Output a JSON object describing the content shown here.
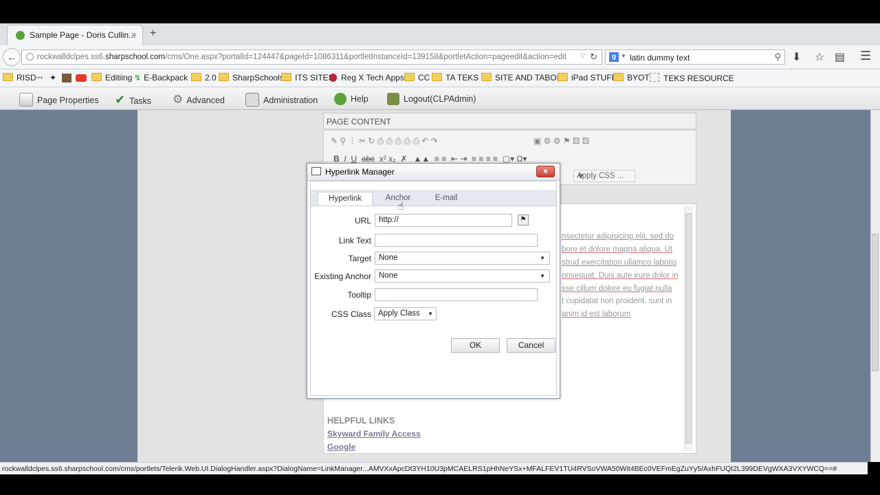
{
  "browser": {
    "tab_title": "Sample Page - Doris Cullin...",
    "tab_close": "×",
    "new_tab": "+",
    "url_host_prefix": "rockwalldclpes.ss6.",
    "url_host": "sharpschool.com",
    "url_path": "/cms/One.aspx?portalId=124447&pageId=1086311&portletInstanceId=139158&portletAction=pageedit&action=edit",
    "search_engine_letter": "g",
    "search_value": "latin dummy text"
  },
  "bookmarks": [
    "RISD",
    "Editiing",
    "E-Backpack",
    "2.0",
    "SharpSchools",
    "ITS SITES",
    "Reg X Tech Apps",
    "CC",
    "TA TEKS",
    "SITE AND TABOR",
    "iPad STUFF",
    "BYOT",
    "TEKS RESOURCE"
  ],
  "cms_toolbar": {
    "page_properties": "Page Properties",
    "tasks": "Tasks",
    "advanced": "Advanced",
    "administration": "Administration",
    "help": "Help",
    "logout": "Logout(CLPAdmin)"
  },
  "editor": {
    "section_title": "PAGE CONTENT",
    "apply_css": "Apply CSS ...",
    "lorem_lines": [
      "nsectetur adipisicing elit, sed do",
      "bore et dolore magna aliqua. Ut",
      "strud exercitation ullamco laboris",
      "onsequat. Duis aute irure dolor in",
      "sse cillum dolore eu fugiat nulla",
      "t cupidatat non proident, sunt in",
      "anim id est laborum"
    ],
    "helpful_links_title": "HELPFUL LINKS",
    "links": [
      "Skyward Family Access",
      "Google"
    ]
  },
  "dialog": {
    "title": "Hyperlink Manager",
    "close": "×",
    "tabs": [
      "Hyperlink",
      "Anchor",
      "E-mail"
    ],
    "selected_tab": "Hyperlink",
    "fields": {
      "url_label": "URL",
      "url_value": "http://",
      "link_text_label": "Link Text",
      "link_text_value": "",
      "target_label": "Target",
      "target_value": "None",
      "existing_anchor_label": "Existing Anchor",
      "existing_anchor_value": "None",
      "tooltip_label": "Tooltip",
      "tooltip_value": "",
      "css_class_label": "CSS Class",
      "css_class_value": "Apply Class"
    },
    "ok_label": "OK",
    "cancel_label": "Cancel"
  },
  "status_bar": "rockwalldclpes.ss6.sharpschool.com/cms/portlets/Telerik.Web.UI.DialogHandler.aspx?DialogName=LinkManager...AMVXxApcDt3YH10U3pMCAELRS1pHhNeYSx+MFALFEV1TU4RVSoVWA50Wit4BEc0VEFmEgZuYy5/AxhFUQI2L399DEVgWXA3VXYWCQ==#"
}
